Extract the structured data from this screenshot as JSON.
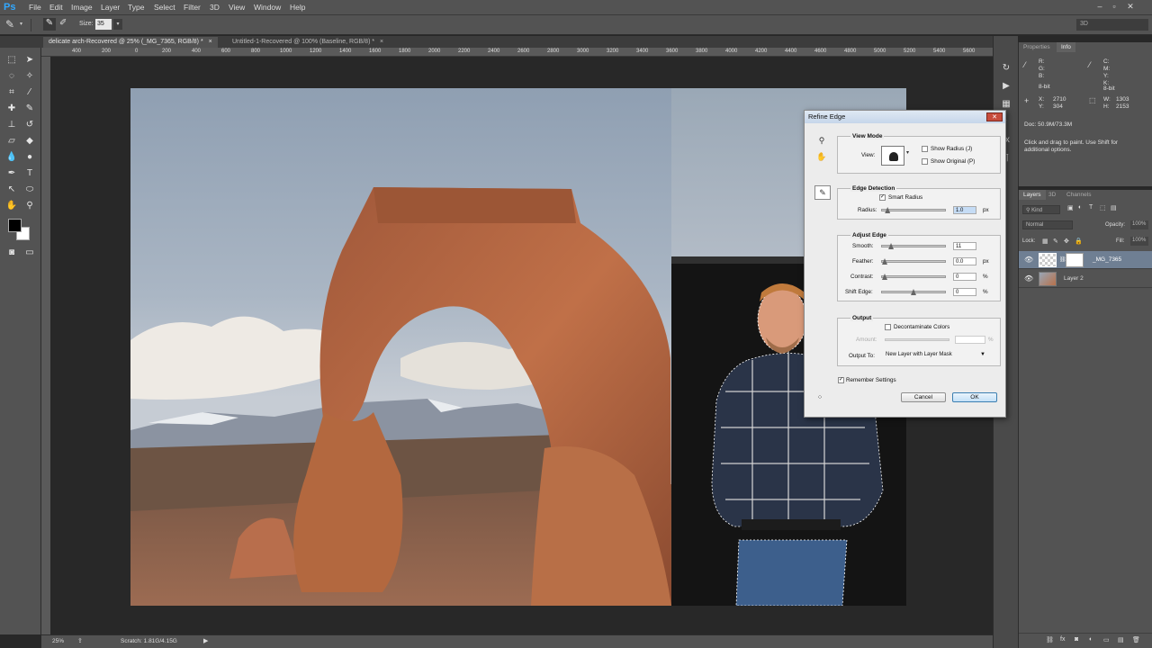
{
  "app": {
    "logo": "Ps"
  },
  "menu": [
    "File",
    "Edit",
    "Image",
    "Layer",
    "Type",
    "Select",
    "Filter",
    "3D",
    "View",
    "Window",
    "Help"
  ],
  "options_bar": {
    "size_label": "Size:",
    "size_value": "35",
    "workspace": "3D"
  },
  "tabs": [
    {
      "label": "delicate arch-Recovered @ 25% (_MG_7365, RGB/8) *",
      "active": true
    },
    {
      "label": "Untitled-1-Recovered @ 100% (Baseline, RGB/8) *",
      "active": false
    }
  ],
  "ruler_top": [
    "400",
    "200",
    "0",
    "200",
    "400",
    "600",
    "800",
    "1000",
    "1200",
    "1400",
    "1600",
    "1800",
    "2000",
    "2200",
    "2400",
    "2600",
    "2800",
    "3000",
    "3200",
    "3400",
    "3600",
    "3800",
    "4000",
    "4200",
    "4400",
    "4600",
    "4800",
    "5000",
    "5200",
    "5400",
    "5600"
  ],
  "status": {
    "zoom": "25%",
    "scratch": "Scratch: 1.81G/4.15G"
  },
  "info_panel": {
    "tabs": [
      "Properties",
      "Info"
    ],
    "rgb_labels": "R:\nG:\nB:",
    "bit_left": "8-bit",
    "cmyk_labels": "C:\nM:\nY:\nK:",
    "bit_right": "8-bit",
    "xy_labels": "X:\nY:",
    "xy_values": "2710\n304",
    "wh_labels": "W:\nH:",
    "wh_values": "1303\n2153",
    "doc": "Doc: 50.9M/73.3M",
    "hint": "Click and drag to paint. Use Shift for additional options."
  },
  "layers_panel": {
    "tabs": [
      "Layers",
      "3D",
      "Channels"
    ],
    "kind": "Kind",
    "blend_mode": "Normal",
    "opacity_label": "Opacity:",
    "opacity_value": "100%",
    "lock_label": "Lock:",
    "fill_label": "Fill:",
    "fill_value": "100%",
    "layers": [
      {
        "name": "_MG_7365",
        "selected": true
      },
      {
        "name": "Layer 2",
        "selected": false
      }
    ]
  },
  "dialog": {
    "title": "Refine Edge",
    "close": "✕",
    "view_mode": {
      "title": "View Mode",
      "view_label": "View:",
      "show_radius": "Show Radius (J)",
      "show_original": "Show Original (P)"
    },
    "edge_detection": {
      "title": "Edge Detection",
      "smart_radius": "Smart Radius",
      "smart_radius_checked": true,
      "radius_label": "Radius:",
      "radius_value": "1.0",
      "radius_unit": "px",
      "radius_level": 0.05
    },
    "adjust_edge": {
      "title": "Adjust Edge",
      "smooth_label": "Smooth:",
      "smooth_value": "11",
      "smooth_level": 0.11,
      "feather_label": "Feather:",
      "feather_value": "0.0",
      "feather_unit": "px",
      "feather_level": 0.0,
      "contrast_label": "Contrast:",
      "contrast_value": "0",
      "contrast_unit": "%",
      "contrast_level": 0.0,
      "shift_label": "Shift Edge:",
      "shift_value": "0",
      "shift_unit": "%",
      "shift_level": 0.5
    },
    "output": {
      "title": "Output",
      "decontaminate": "Decontaminate Colors",
      "amount_label": "Amount:",
      "amount_unit": "%",
      "output_to_label": "Output To:",
      "output_to_value": "New Layer with Layer Mask"
    },
    "remember": "Remember Settings",
    "remember_checked": true,
    "cancel": "Cancel",
    "ok": "OK"
  }
}
